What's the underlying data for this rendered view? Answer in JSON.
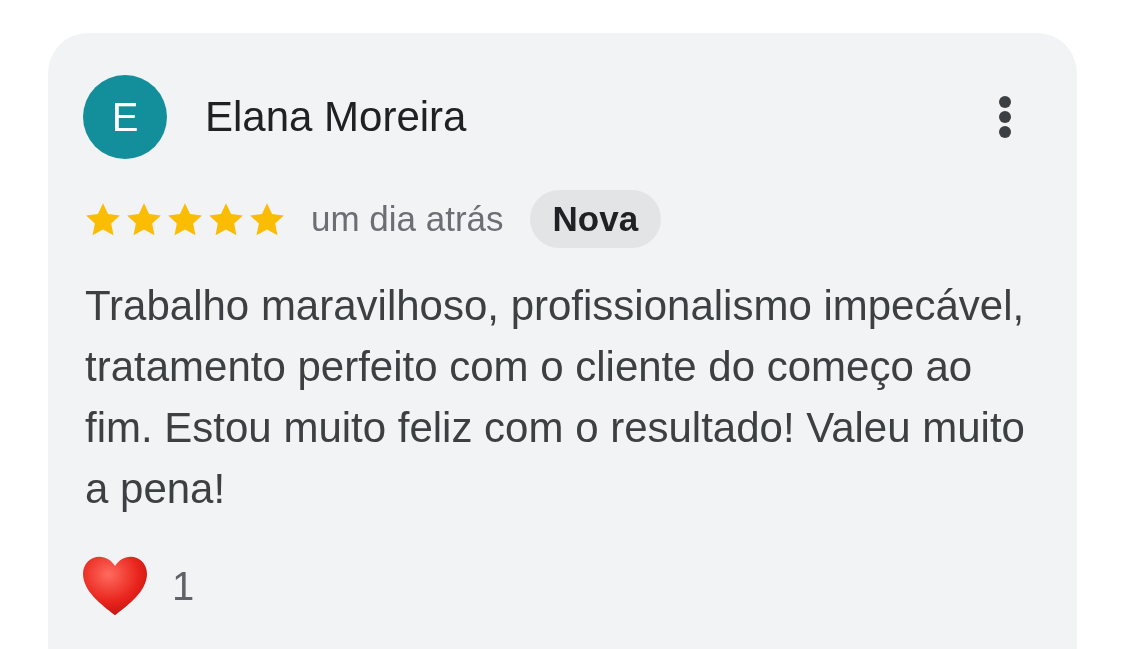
{
  "review": {
    "author": {
      "initial": "E",
      "name": "Elana Moreira"
    },
    "stars": 5,
    "time": "um dia atrás",
    "badge": "Nova",
    "text": "Trabalho maravilhoso, profissionalismo impecável, tratamento perfeito com o cliente do começo ao fim. Estou muito feliz com o resultado! Valeu muito a pena!",
    "reactions": [
      {
        "kind": "heart",
        "count": "1"
      }
    ]
  }
}
